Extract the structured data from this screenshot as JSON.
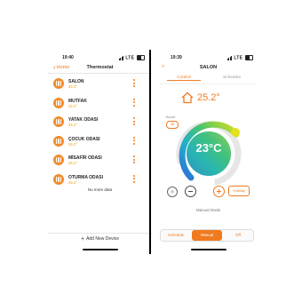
{
  "left": {
    "status": {
      "time": "19:40",
      "network": "LTE"
    },
    "nav": {
      "back_label": "Home",
      "title": "Thermostat"
    },
    "devices": [
      {
        "name": "SALON",
        "temp": "25.2°"
      },
      {
        "name": "MUTFAK",
        "temp": "25.2°"
      },
      {
        "name": "YATAK ODASI",
        "temp": "25.2°"
      },
      {
        "name": "ÇOCUK ODASI",
        "temp": "25.2°"
      },
      {
        "name": "MİSAFİR ODASI",
        "temp": "25.2°"
      },
      {
        "name": "OTURMA ODASI",
        "temp": "25.2°"
      }
    ],
    "no_more": "No more data",
    "add_device": "Add New Device"
  },
  "right": {
    "status": {
      "time": "19:39",
      "network": "LTE"
    },
    "title": "SALON",
    "tabs": [
      {
        "label": "Control",
        "active": true
      },
      {
        "label": "Schedule",
        "active": false
      }
    ],
    "room_temp": "25.2°",
    "boost": {
      "label": "Boost",
      "state": "Off"
    },
    "setpoint": "23°C",
    "holiday_label": "Holiday",
    "manual_mode": "Manual Mode",
    "modes": [
      {
        "label": "Schedule",
        "active": false
      },
      {
        "label": "Manual",
        "active": true
      },
      {
        "label": "Off",
        "active": false
      }
    ]
  },
  "colors": {
    "accent": "#f07a1f",
    "temp_text": "#e8a31a"
  },
  "icons": [
    "chevron-left-icon",
    "heater-icon",
    "more-vertical-icon",
    "plus-icon",
    "search-icon",
    "house-icon",
    "mode-icon",
    "minus-icon"
  ]
}
